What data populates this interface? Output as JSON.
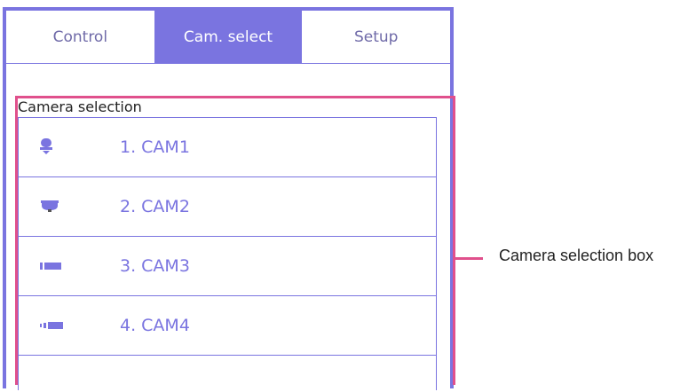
{
  "tabs": [
    {
      "label": "Control",
      "active": false
    },
    {
      "label": "Cam. select",
      "active": true
    },
    {
      "label": "Setup",
      "active": false
    }
  ],
  "camera_selection": {
    "title": "Camera selection",
    "cameras": [
      {
        "label": "1. CAM1",
        "icon": "dome-camera-icon"
      },
      {
        "label": "2. CAM2",
        "icon": "ceiling-dome-camera-icon"
      },
      {
        "label": "3. CAM3",
        "icon": "box-camera-icon"
      },
      {
        "label": "4. CAM4",
        "icon": "bullet-camera-icon"
      }
    ]
  },
  "annotation": {
    "text": "Camera selection box"
  },
  "colors": {
    "accent": "#7a74e0",
    "highlight": "#e0508c"
  }
}
